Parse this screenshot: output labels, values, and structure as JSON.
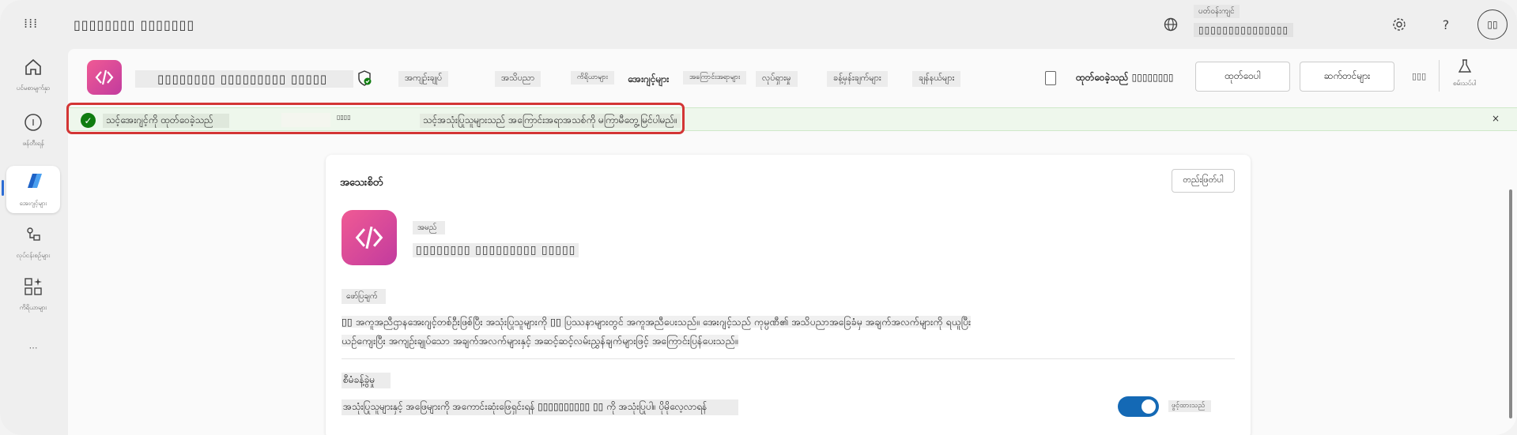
{
  "topbar": {
    "waffle": "⁞⁞⁞",
    "app_title": "▯▯▯▯▯▯▯▯ ▯▯▯▯▯▯▯",
    "env_label": "ပတ်ဝန်းကျင်",
    "env_value": "▯▯▯▯▯▯▯▯▯▯▯▯▯▯▯",
    "help": "?",
    "avatar": "▯▯"
  },
  "rail": {
    "home": "ပင်မစာမျက်နှာ",
    "create": "ဖန်တီးရန်",
    "agents": "အေးဂျင့်များ",
    "flows": "လုပ်ငန်းစဉ်များ",
    "tools": "ကိရိယာများ",
    "more": "⋯"
  },
  "cmdbar": {
    "app_name": "▯▯▯▯▯▯▯▯ ▯▯▯▯▯▯▯▯▯ ▯▯▯▯▯",
    "tabs": [
      "အကျဉ်းချုပ်",
      "အသိပညာ",
      "ကိရိယာများ",
      "အေးဂျင့်များ",
      "အကြောင်းအရာများ",
      "လုပ်ရှားမှု",
      "ခန့်မှန်းချက်များ",
      "ချန်နယ်များ"
    ],
    "status": "ထုတ်ဝေခဲ့သည် ▯▯▯▯▯▯▯▯",
    "publish": "ထုတ်ဝေပါ",
    "settings": "ဆက်တင်များ",
    "more": "▯▯▯",
    "test": "စမ်းသပ်ပါ"
  },
  "banner": {
    "message": "သင့်အေးဂျင့်ကို ထုတ်ဝေခဲ့သည်",
    "link": "▯▯▯▯",
    "info": "သင့်အသုံးပြုသူများသည် အကြောင်းအရာအသစ်ကို မကြာမီတွေ့မြင်ပါမည်။",
    "close": "×"
  },
  "card": {
    "title": "အသေးစိတ်",
    "edit": "တည်းဖြတ်ပါ",
    "name_label": "အမည်",
    "name_value": "▯▯▯▯▯▯▯▯ ▯▯▯▯▯▯▯▯▯ ▯▯▯▯▯",
    "desc_label": "ဖော်ပြချက်",
    "desc_line1": "▯▯ အကူအညီဌာနအေးဂျင့်တစ်ဦးဖြစ်ပြီး အသုံးပြုသူများကို ▯▯ ပြဿနာများတွင် အကူအညီပေးသည်။ အေးဂျင့်သည် ကုမ္ပဏီ၏ အသိပညာအခြေခံမှ အချက်အလက်များကို ရယူပြီး",
    "desc_line2": "ယဉ်ကျေးပြီး အကျဉ်းချုပ်သော အချက်အလက်များနှင့် အဆင့်ဆင့်လမ်းညွှန်ချက်များဖြင့် အကြောင်းပြန်ပေးသည်။",
    "train_label": "စီမံခန့်ခွဲမှု",
    "train_text": "အသုံးပြုသူများနှင့် အဖြေများကို အကောင်းဆုံးဖြေရှင်းရန် ▯▯▯▯▯▯▯▯▯▯ ▯▯ ကို အသုံးပြုပါ။ ပိုမိုလေ့လာရန်",
    "toggle_label": "ဖွင့်ထားသည်",
    "toggle_on": true
  },
  "colors": {
    "accent": "#1469b5",
    "success": "#107c10",
    "brand_gradient_start": "#f05a94",
    "brand_gradient_end": "#c23b9e",
    "highlight": "#d33535"
  }
}
